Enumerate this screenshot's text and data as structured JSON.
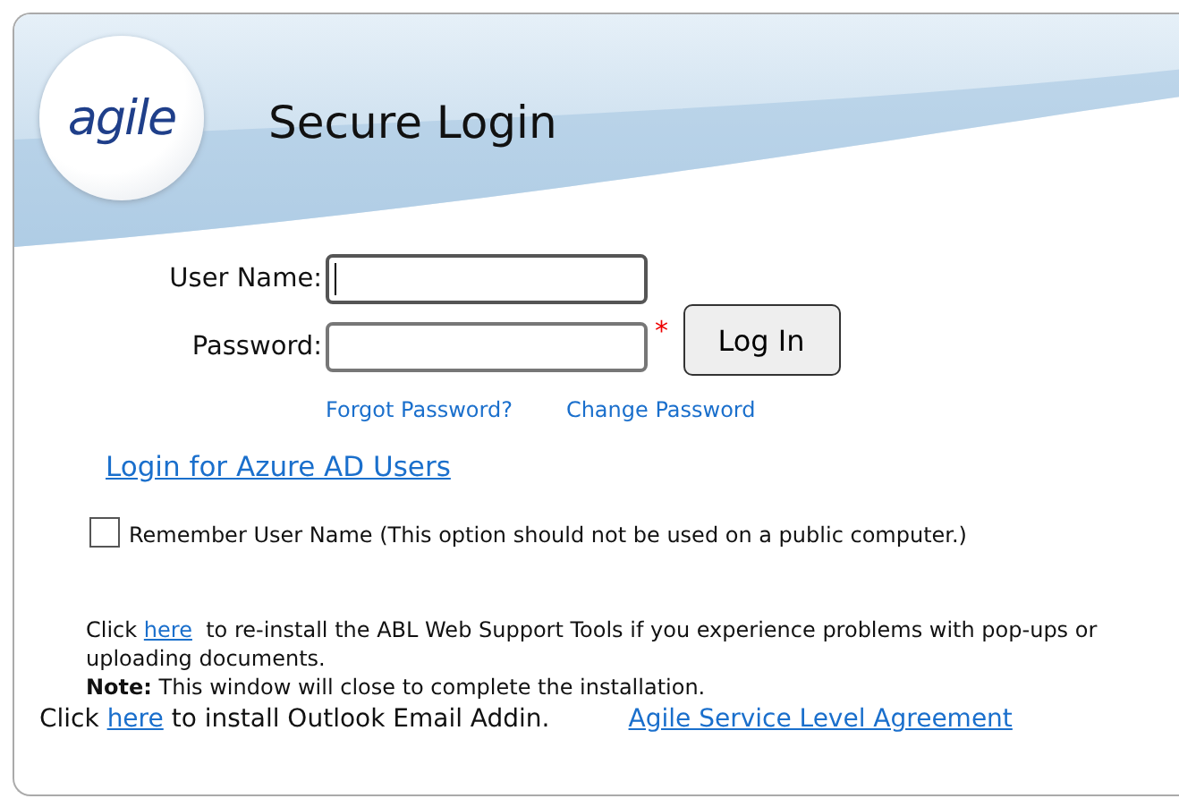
{
  "header": {
    "logo": "agile",
    "title": "Secure Login"
  },
  "form": {
    "fields": [
      {
        "label": "User Name:",
        "focused": true
      },
      {
        "label": "Password:",
        "focused": false,
        "required_mark": "*"
      }
    ],
    "submit": "Log In",
    "links": [
      "Forgot Password?",
      "Change Password"
    ]
  },
  "azure_link": "Login for Azure AD Users",
  "remember": {
    "label": "Remember User Name (This option should not be used on a public computer.)",
    "checked": false
  },
  "reinstall": {
    "before": "Click",
    "link": "here",
    "after": "to re-install the ABL Web Support Tools if you experience problems with pop-ups or uploading documents.",
    "note": "**Note:** This window will close to complete the installation."
  },
  "outlook": {
    "before": "Click",
    "link": "here",
    "after": "to install Outlook Email Addin."
  },
  "sla_link": "Agile Service Level Agreement"
}
